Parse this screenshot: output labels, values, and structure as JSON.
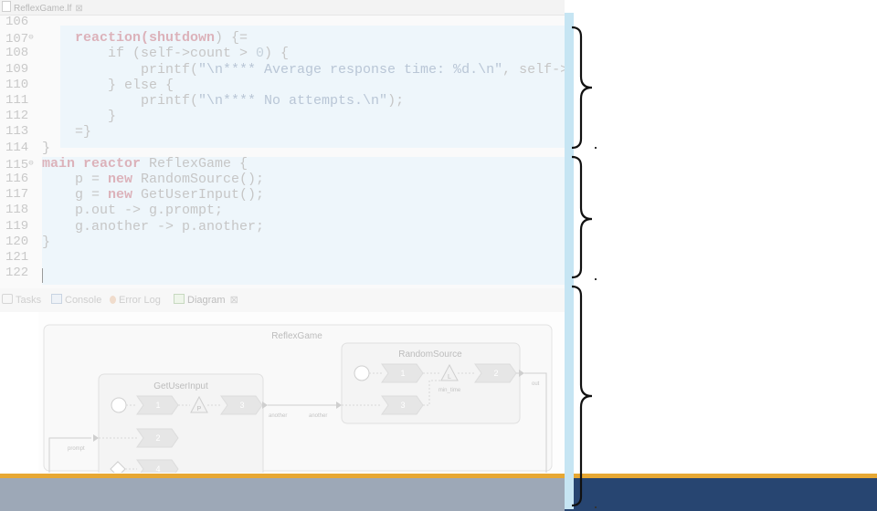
{
  "editor": {
    "tab_label": "ReflexGame.lf",
    "tab_close": "⊠",
    "line_numbers": [
      "106",
      "107",
      "108",
      "109",
      "110",
      "111",
      "112",
      "113",
      "114",
      "115",
      "116",
      "117",
      "118",
      "119",
      "120",
      "121",
      "122"
    ],
    "fold_markers": {
      "107": "⊖",
      "115": "⊖"
    },
    "code": {
      "l107_kw": "reaction",
      "l107_a": "(",
      "l107_kw2": "shutdown",
      "l107_b": ") {=",
      "l108_a": "if (self->count > ",
      "l108_num": "0",
      "l108_b": ") {",
      "l109_a": "printf(",
      "l109_str": "\"\\n**** Average response time: %d.\\n\"",
      "l109_b": ", self->",
      "l110": "} else {",
      "l111_a": "printf(",
      "l111_str": "\"\\n**** No attempts.\\n\"",
      "l111_b": ");",
      "l112": "}",
      "l113": "=}",
      "l114": "}",
      "l115_kw": "main reactor",
      "l115_b": " ReflexGame {",
      "l116_a": "p = ",
      "l116_kw": "new",
      "l116_b": " RandomSource();",
      "l117_a": "g = ",
      "l117_kw": "new",
      "l117_b": " GetUserInput();",
      "l118": "p.out -> g.prompt;",
      "l119": "g.another -> p.another;",
      "l120": "}"
    }
  },
  "views": {
    "tabs": [
      {
        "label": "Tasks"
      },
      {
        "label": "Console"
      },
      {
        "label": "Error Log"
      },
      {
        "label": "Diagram"
      }
    ],
    "diagram_close": "⊠"
  },
  "diagram": {
    "title": "ReflexGame",
    "get_user_input": {
      "title": "GetUserInput",
      "reaction_1": "1",
      "reaction_2": "2",
      "reaction_3": "3",
      "reaction_4": "4",
      "action_label": "P",
      "port_prompt": "prompt",
      "port_another": "another"
    },
    "random_source": {
      "title": "RandomSource",
      "reaction_1": "1",
      "reaction_2": "2",
      "reaction_3": "3",
      "action_label": "L",
      "action_name": "min_time",
      "port_out": "out",
      "port_another": "another"
    }
  },
  "colors": {
    "band": "#274571",
    "band_accent": "#e7a834",
    "highlight_strip": "#c6e5f3"
  }
}
